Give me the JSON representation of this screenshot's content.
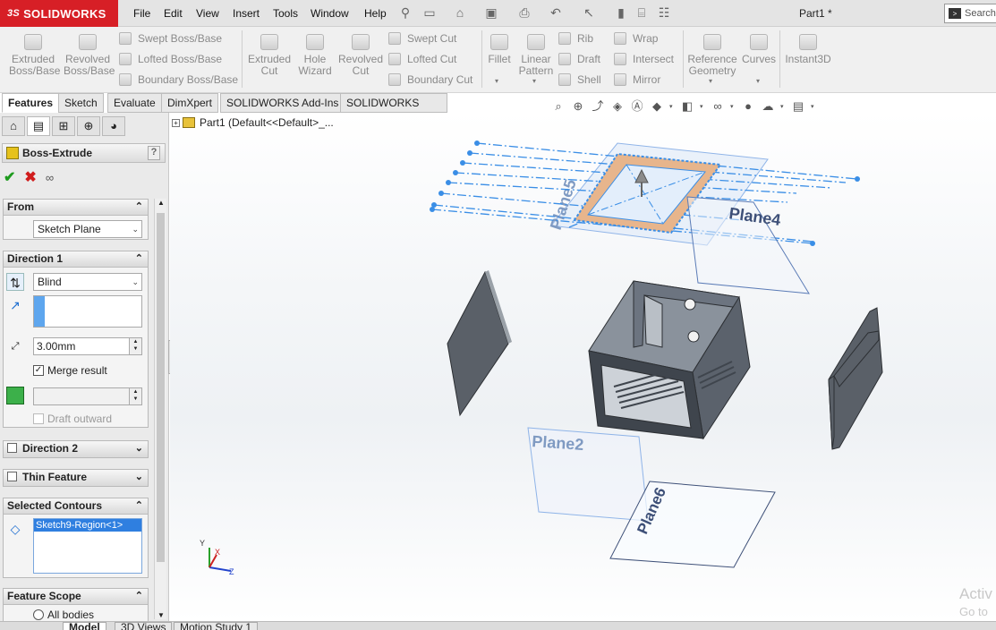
{
  "app": {
    "brand": "SOLIDWORKS",
    "brand_prefix": "3S",
    "doc_title": "Part1 *"
  },
  "menu": [
    "File",
    "Edit",
    "View",
    "Insert",
    "Tools",
    "Window",
    "Help"
  ],
  "search": {
    "label": "Search"
  },
  "ribbon": {
    "extruded_boss": "Extruded\nBoss/Base",
    "revolved_boss": "Revolved\nBoss/Base",
    "swept_boss": "Swept Boss/Base",
    "lofted_boss": "Lofted Boss/Base",
    "boundary_boss": "Boundary Boss/Base",
    "extruded_cut": "Extruded\nCut",
    "hole_wizard": "Hole\nWizard",
    "revolved_cut": "Revolved\nCut",
    "swept_cut": "Swept Cut",
    "lofted_cut": "Lofted Cut",
    "boundary_cut": "Boundary Cut",
    "fillet": "Fillet",
    "linear_pattern": "Linear\nPattern",
    "rib": "Rib",
    "draft": "Draft",
    "shell": "Shell",
    "wrap": "Wrap",
    "intersect": "Intersect",
    "mirror": "Mirror",
    "reference_geometry": "Reference\nGeometry",
    "curves": "Curves",
    "instant3d": "Instant3D"
  },
  "command_tabs": [
    "Features",
    "Sketch",
    "Evaluate",
    "DimXpert",
    "SOLIDWORKS Add-Ins",
    "SOLIDWORKS MBD"
  ],
  "property_manager": {
    "title": "Boss-Extrude",
    "help": "?",
    "from": {
      "header": "From",
      "value": "Sketch Plane"
    },
    "direction1": {
      "header": "Direction 1",
      "end_condition": "Blind",
      "depth": "3.00mm",
      "merge_label": "Merge result",
      "merge_checked": true,
      "draft_label": "Draft outward"
    },
    "direction2": {
      "header": "Direction 2"
    },
    "thin_feature": {
      "header": "Thin Feature"
    },
    "selected_contours": {
      "header": "Selected Contours",
      "items": [
        "Sketch9-Region<1>"
      ]
    },
    "feature_scope": {
      "header": "Feature Scope",
      "option": "All bodies"
    }
  },
  "tree": {
    "root": "Part1  (Default<<Default>_..."
  },
  "planes": {
    "plane2": "Plane2",
    "plane4": "Plane4",
    "plane5": "Plane5",
    "plane6": "Plane6"
  },
  "triad": {
    "x": "X",
    "y": "Y",
    "z": "Z"
  },
  "bottom_tabs": [
    "Model",
    "3D Views",
    "Motion Study 1"
  ],
  "watermark": {
    "line1": "Activ",
    "line2": "Go to"
  },
  "colors": {
    "brand_red": "#d71f26",
    "sketch_blue": "#3a8ee6",
    "body_gray": "#6c7480",
    "plane_blue": "#8fb4e8"
  }
}
